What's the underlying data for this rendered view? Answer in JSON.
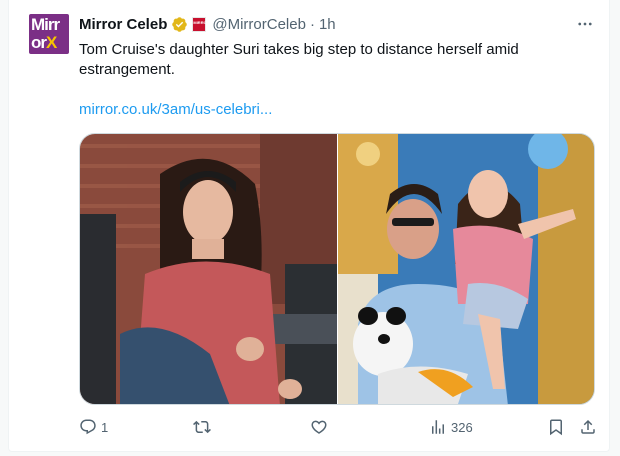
{
  "post": {
    "author_name": "Mirror Celeb",
    "handle": "@MirrorCeleb",
    "separator": "·",
    "time": "1h",
    "avatar_logo": {
      "line1": "Mirr",
      "line2a": "or",
      "line2b": "X"
    },
    "text": "Tom Cruise's daughter Suri takes big step to distance herself amid estrangement.",
    "link": "mirror.co.uk/3am/us-celebri...",
    "images": [
      {
        "icon": "photo-woman-headphones"
      },
      {
        "icon": "photo-man-carrying-child"
      }
    ]
  },
  "actions": {
    "reply_count": "1",
    "repost_count": "",
    "like_count": "",
    "views_count": "326"
  },
  "colors": {
    "link": "#1d9bf0",
    "verified_gold": "#e2b719",
    "secondary_text": "#536471",
    "brand_purple": "#7b2f86"
  }
}
